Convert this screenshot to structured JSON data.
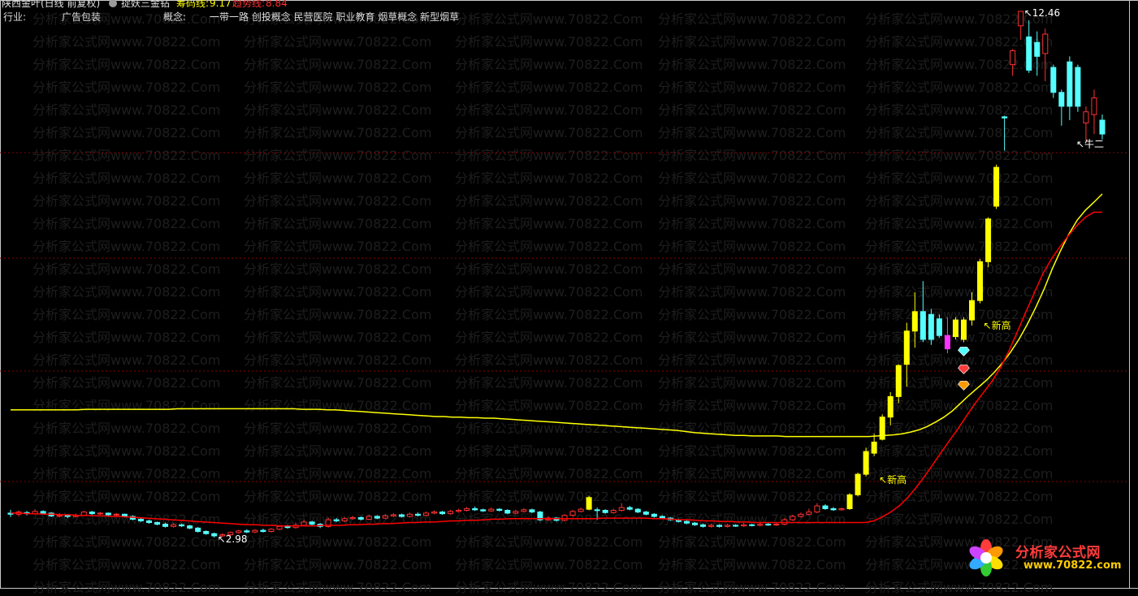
{
  "header": {
    "stock_name": "陕西金叶(日线 前复权)",
    "indicator_icon": "gear-icon",
    "indicator_name": "捉妖三金钻",
    "cost_label": "筹码线:",
    "cost_value": "9.17",
    "trend_label": "趋势线:",
    "trend_value": "8.84",
    "industry_label": "行业:",
    "industry_value": "广告包装",
    "concept_label": "概念:",
    "concept_value": "一带一路 创投概念 民营医院 职业教育 烟草概念 新型烟草"
  },
  "annotations": {
    "high_price": "12.46",
    "low_price": "2.98",
    "new_high_1": "新高",
    "new_high_2": "新高",
    "niu_er": "牛二",
    "arrow": "↖"
  },
  "watermark": {
    "text": "分析家公式网www.70822.Com"
  },
  "logo": {
    "name": "分析家公式网",
    "url": "www.70822.com"
  },
  "colors": {
    "up": "#ff3232",
    "down": "#54ffff",
    "strong_up": "#ffff00",
    "magenta": "#ff33ff",
    "cost_line": "#ffff00",
    "trend_line": "#ff0000",
    "grid": "#8b0000"
  },
  "chart_data": {
    "type": "candlestick",
    "title": "陕西金叶(日线 前复权)",
    "price_range": [
      2.98,
      12.46
    ],
    "series": [
      {
        "name": "筹码线",
        "last": 9.17
      },
      {
        "name": "趋势线",
        "last": 8.84
      }
    ],
    "candles": [
      {
        "o": 3.42,
        "c": 3.4,
        "h": 3.48,
        "l": 3.35
      },
      {
        "o": 3.4,
        "c": 3.44,
        "h": 3.47,
        "l": 3.36
      },
      {
        "o": 3.43,
        "c": 3.41,
        "h": 3.46,
        "l": 3.38
      },
      {
        "o": 3.41,
        "c": 3.45,
        "h": 3.49,
        "l": 3.39
      },
      {
        "o": 3.45,
        "c": 3.42,
        "h": 3.47,
        "l": 3.4
      },
      {
        "o": 3.42,
        "c": 3.37,
        "h": 3.44,
        "l": 3.35
      },
      {
        "o": 3.37,
        "c": 3.38,
        "h": 3.42,
        "l": 3.34
      },
      {
        "o": 3.38,
        "c": 3.36,
        "h": 3.4,
        "l": 3.33
      },
      {
        "o": 3.36,
        "c": 3.38,
        "h": 3.41,
        "l": 3.34
      },
      {
        "o": 3.38,
        "c": 3.44,
        "h": 3.46,
        "l": 3.37
      },
      {
        "o": 3.44,
        "c": 3.41,
        "h": 3.46,
        "l": 3.39
      },
      {
        "o": 3.41,
        "c": 3.42,
        "h": 3.44,
        "l": 3.39
      },
      {
        "o": 3.42,
        "c": 3.39,
        "h": 3.43,
        "l": 3.37
      },
      {
        "o": 3.39,
        "c": 3.4,
        "h": 3.42,
        "l": 3.37
      },
      {
        "o": 3.4,
        "c": 3.36,
        "h": 3.41,
        "l": 3.34
      },
      {
        "o": 3.36,
        "c": 3.31,
        "h": 3.38,
        "l": 3.29
      },
      {
        "o": 3.31,
        "c": 3.28,
        "h": 3.33,
        "l": 3.26
      },
      {
        "o": 3.28,
        "c": 3.25,
        "h": 3.3,
        "l": 3.23
      },
      {
        "o": 3.25,
        "c": 3.22,
        "h": 3.27,
        "l": 3.2
      },
      {
        "o": 3.22,
        "c": 3.18,
        "h": 3.25,
        "l": 3.16
      },
      {
        "o": 3.18,
        "c": 3.21,
        "h": 3.24,
        "l": 3.16
      },
      {
        "o": 3.21,
        "c": 3.19,
        "h": 3.23,
        "l": 3.17
      },
      {
        "o": 3.19,
        "c": 3.15,
        "h": 3.21,
        "l": 3.13
      },
      {
        "o": 3.15,
        "c": 3.09,
        "h": 3.17,
        "l": 3.07
      },
      {
        "o": 3.09,
        "c": 3.05,
        "h": 3.11,
        "l": 3.03
      },
      {
        "o": 3.05,
        "c": 3.01,
        "h": 3.07,
        "l": 2.98
      },
      {
        "o": 3.01,
        "c": 3.03,
        "h": 3.06,
        "l": 2.99
      },
      {
        "o": 3.03,
        "c": 3.07,
        "h": 3.09,
        "l": 3.01
      },
      {
        "o": 3.07,
        "c": 3.1,
        "h": 3.12,
        "l": 3.05
      },
      {
        "o": 3.1,
        "c": 3.08,
        "h": 3.13,
        "l": 3.06
      },
      {
        "o": 3.08,
        "c": 3.11,
        "h": 3.13,
        "l": 3.06
      },
      {
        "o": 3.11,
        "c": 3.09,
        "h": 3.14,
        "l": 3.07
      },
      {
        "o": 3.09,
        "c": 3.13,
        "h": 3.15,
        "l": 3.07
      },
      {
        "o": 3.13,
        "c": 3.18,
        "h": 3.2,
        "l": 3.11
      },
      {
        "o": 3.18,
        "c": 3.16,
        "h": 3.21,
        "l": 3.14
      },
      {
        "o": 3.16,
        "c": 3.2,
        "h": 3.25,
        "l": 3.14
      },
      {
        "o": 3.2,
        "c": 3.26,
        "h": 3.3,
        "l": 3.18
      },
      {
        "o": 3.26,
        "c": 3.22,
        "h": 3.28,
        "l": 3.2
      },
      {
        "o": 3.22,
        "c": 3.18,
        "h": 3.24,
        "l": 3.15
      },
      {
        "o": 3.18,
        "c": 3.3,
        "h": 3.34,
        "l": 3.16
      },
      {
        "o": 3.3,
        "c": 3.28,
        "h": 3.33,
        "l": 3.26
      },
      {
        "o": 3.28,
        "c": 3.32,
        "h": 3.35,
        "l": 3.26
      },
      {
        "o": 3.32,
        "c": 3.34,
        "h": 3.37,
        "l": 3.3
      },
      {
        "o": 3.34,
        "c": 3.31,
        "h": 3.36,
        "l": 3.29
      },
      {
        "o": 3.31,
        "c": 3.36,
        "h": 3.39,
        "l": 3.29
      },
      {
        "o": 3.36,
        "c": 3.33,
        "h": 3.38,
        "l": 3.31
      },
      {
        "o": 3.33,
        "c": 3.37,
        "h": 3.4,
        "l": 3.31
      },
      {
        "o": 3.37,
        "c": 3.39,
        "h": 3.42,
        "l": 3.35
      },
      {
        "o": 3.39,
        "c": 3.36,
        "h": 3.41,
        "l": 3.34
      },
      {
        "o": 3.36,
        "c": 3.4,
        "h": 3.43,
        "l": 3.34
      },
      {
        "o": 3.4,
        "c": 3.38,
        "h": 3.43,
        "l": 3.36
      },
      {
        "o": 3.38,
        "c": 3.42,
        "h": 3.45,
        "l": 3.36
      },
      {
        "o": 3.42,
        "c": 3.44,
        "h": 3.47,
        "l": 3.4
      },
      {
        "o": 3.44,
        "c": 3.41,
        "h": 3.46,
        "l": 3.39
      },
      {
        "o": 3.41,
        "c": 3.45,
        "h": 3.48,
        "l": 3.39
      },
      {
        "o": 3.45,
        "c": 3.47,
        "h": 3.5,
        "l": 3.43
      },
      {
        "o": 3.47,
        "c": 3.5,
        "h": 3.53,
        "l": 3.45
      },
      {
        "o": 3.5,
        "c": 3.48,
        "h": 3.54,
        "l": 3.46
      },
      {
        "o": 3.48,
        "c": 3.46,
        "h": 3.5,
        "l": 3.44
      },
      {
        "o": 3.46,
        "c": 3.49,
        "h": 3.52,
        "l": 3.44
      },
      {
        "o": 3.49,
        "c": 3.47,
        "h": 3.51,
        "l": 3.45
      },
      {
        "o": 3.47,
        "c": 3.42,
        "h": 3.49,
        "l": 3.4
      },
      {
        "o": 3.42,
        "c": 3.45,
        "h": 3.48,
        "l": 3.4
      },
      {
        "o": 3.45,
        "c": 3.48,
        "h": 3.51,
        "l": 3.43
      },
      {
        "o": 3.48,
        "c": 3.44,
        "h": 3.5,
        "l": 3.42
      },
      {
        "o": 3.44,
        "c": 3.3,
        "h": 3.46,
        "l": 3.28
      },
      {
        "o": 3.3,
        "c": 3.33,
        "h": 3.36,
        "l": 3.28
      },
      {
        "o": 3.33,
        "c": 3.29,
        "h": 3.35,
        "l": 3.27
      },
      {
        "o": 3.29,
        "c": 3.38,
        "h": 3.4,
        "l": 3.27
      },
      {
        "o": 3.38,
        "c": 3.45,
        "h": 3.48,
        "l": 3.36
      },
      {
        "o": 3.45,
        "c": 3.49,
        "h": 3.52,
        "l": 3.43
      },
      {
        "o": 3.49,
        "c": 3.7,
        "h": 3.73,
        "l": 3.47
      },
      {
        "o": 3.48,
        "c": 3.47,
        "h": 3.52,
        "l": 3.3
      },
      {
        "o": 3.47,
        "c": 3.43,
        "h": 3.49,
        "l": 3.41
      },
      {
        "o": 3.43,
        "c": 3.47,
        "h": 3.5,
        "l": 3.41
      },
      {
        "o": 3.47,
        "c": 3.52,
        "h": 3.6,
        "l": 3.45
      },
      {
        "o": 3.52,
        "c": 3.49,
        "h": 3.55,
        "l": 3.47
      },
      {
        "o": 3.49,
        "c": 3.44,
        "h": 3.51,
        "l": 3.42
      },
      {
        "o": 3.44,
        "c": 3.4,
        "h": 3.46,
        "l": 3.38
      },
      {
        "o": 3.4,
        "c": 3.36,
        "h": 3.42,
        "l": 3.34
      },
      {
        "o": 3.36,
        "c": 3.33,
        "h": 3.38,
        "l": 3.31
      },
      {
        "o": 3.33,
        "c": 3.3,
        "h": 3.35,
        "l": 3.28
      },
      {
        "o": 3.3,
        "c": 3.27,
        "h": 3.32,
        "l": 3.25
      },
      {
        "o": 3.27,
        "c": 3.24,
        "h": 3.29,
        "l": 3.22
      },
      {
        "o": 3.24,
        "c": 3.21,
        "h": 3.26,
        "l": 3.19
      },
      {
        "o": 3.21,
        "c": 3.18,
        "h": 3.23,
        "l": 3.16
      },
      {
        "o": 3.18,
        "c": 3.2,
        "h": 3.23,
        "l": 3.16
      },
      {
        "o": 3.2,
        "c": 3.18,
        "h": 3.22,
        "l": 3.16
      },
      {
        "o": 3.18,
        "c": 3.2,
        "h": 3.23,
        "l": 3.16
      },
      {
        "o": 3.2,
        "c": 3.19,
        "h": 3.22,
        "l": 3.17
      },
      {
        "o": 3.19,
        "c": 3.21,
        "h": 3.24,
        "l": 3.17
      },
      {
        "o": 3.21,
        "c": 3.2,
        "h": 3.23,
        "l": 3.18
      },
      {
        "o": 3.2,
        "c": 3.22,
        "h": 3.25,
        "l": 3.18
      },
      {
        "o": 3.22,
        "c": 3.21,
        "h": 3.24,
        "l": 3.19
      },
      {
        "o": 3.21,
        "c": 3.22,
        "h": 3.25,
        "l": 3.19
      },
      {
        "o": 3.22,
        "c": 3.3,
        "h": 3.33,
        "l": 3.2
      },
      {
        "o": 3.3,
        "c": 3.36,
        "h": 3.39,
        "l": 3.28
      },
      {
        "o": 3.36,
        "c": 3.4,
        "h": 3.43,
        "l": 3.34
      },
      {
        "o": 3.4,
        "c": 3.44,
        "h": 3.5,
        "l": 3.38
      },
      {
        "o": 3.44,
        "c": 3.55,
        "h": 3.6,
        "l": 3.42
      },
      {
        "o": 3.55,
        "c": 3.5,
        "h": 3.58,
        "l": 3.48
      },
      {
        "o": 3.5,
        "c": 3.48,
        "h": 3.53,
        "l": 3.46
      },
      {
        "o": 3.48,
        "c": 3.5,
        "h": 3.52,
        "l": 3.46
      },
      {
        "o": 3.5,
        "c": 3.75,
        "h": 3.78,
        "l": 3.48
      },
      {
        "o": 3.75,
        "c": 4.12,
        "h": 4.15,
        "l": 3.72
      },
      {
        "o": 4.12,
        "c": 4.53,
        "h": 4.6,
        "l": 4.08
      },
      {
        "o": 4.5,
        "c": 4.7,
        "h": 4.85,
        "l": 4.45
      },
      {
        "o": 4.75,
        "c": 5.15,
        "h": 5.2,
        "l": 4.73
      },
      {
        "o": 5.15,
        "c": 5.52,
        "h": 5.6,
        "l": 5.0
      },
      {
        "o": 5.52,
        "c": 6.08,
        "h": 6.1,
        "l": 5.4
      },
      {
        "o": 6.1,
        "c": 6.7,
        "h": 6.85,
        "l": 5.7
      },
      {
        "o": 6.7,
        "c": 7.05,
        "h": 7.4,
        "l": 6.4
      },
      {
        "o": 7.05,
        "c": 6.55,
        "h": 7.6,
        "l": 6.5
      },
      {
        "o": 7.0,
        "c": 6.55,
        "h": 7.1,
        "l": 6.45
      },
      {
        "o": 6.92,
        "c": 6.62,
        "h": 7.0,
        "l": 6.58
      },
      {
        "o": 6.38,
        "c": 6.62,
        "h": 6.95,
        "l": 6.3
      },
      {
        "o": 6.6,
        "c": 6.9,
        "h": 6.95,
        "l": 6.55
      },
      {
        "o": 6.55,
        "c": 6.9,
        "h": 6.95,
        "l": 6.5
      },
      {
        "o": 6.9,
        "c": 7.25,
        "h": 7.4,
        "l": 6.8
      },
      {
        "o": 7.25,
        "c": 7.95,
        "h": 8.0,
        "l": 7.2
      },
      {
        "o": 7.95,
        "c": 8.72,
        "h": 8.75,
        "l": 7.85
      },
      {
        "o": 8.95,
        "c": 9.65,
        "h": 9.7,
        "l": 8.9
      },
      {
        "o": 10.56,
        "c": 10.54,
        "h": 10.58,
        "l": 9.95
      },
      {
        "o": 11.5,
        "c": 11.75,
        "h": 11.78,
        "l": 11.3
      },
      {
        "o": 12.2,
        "c": 12.46,
        "h": 12.46,
        "l": 11.95
      },
      {
        "o": 12.0,
        "c": 11.4,
        "h": 12.3,
        "l": 11.35
      },
      {
        "o": 11.9,
        "c": 11.65,
        "h": 12.1,
        "l": 11.3
      },
      {
        "o": 11.7,
        "c": 12.05,
        "h": 12.15,
        "l": 11.2
      },
      {
        "o": 11.45,
        "c": 11.0,
        "h": 11.5,
        "l": 10.9
      },
      {
        "o": 11.0,
        "c": 10.75,
        "h": 11.05,
        "l": 10.4
      },
      {
        "o": 11.55,
        "c": 10.75,
        "h": 11.65,
        "l": 10.5
      },
      {
        "o": 11.45,
        "c": 10.75,
        "h": 11.5,
        "l": 10.65
      },
      {
        "o": 10.45,
        "c": 10.65,
        "h": 10.75,
        "l": 10.1
      },
      {
        "o": 10.6,
        "c": 10.9,
        "h": 11.05,
        "l": 10.25
      },
      {
        "o": 10.5,
        "c": 10.25,
        "h": 10.6,
        "l": 10.15
      }
    ],
    "cost_line": [
      5.28,
      5.28,
      5.28,
      5.28,
      5.28,
      5.28,
      5.28,
      5.28,
      5.28,
      5.29,
      5.29,
      5.29,
      5.29,
      5.29,
      5.29,
      5.29,
      5.29,
      5.29,
      5.29,
      5.29,
      5.3,
      5.3,
      5.3,
      5.3,
      5.3,
      5.3,
      5.3,
      5.3,
      5.3,
      5.3,
      5.3,
      5.3,
      5.3,
      5.3,
      5.3,
      5.29,
      5.29,
      5.29,
      5.28,
      5.28,
      5.27,
      5.26,
      5.25,
      5.24,
      5.23,
      5.22,
      5.21,
      5.2,
      5.19,
      5.18,
      5.17,
      5.16,
      5.16,
      5.15,
      5.15,
      5.14,
      5.14,
      5.13,
      5.13,
      5.12,
      5.11,
      5.1,
      5.09,
      5.08,
      5.07,
      5.06,
      5.05,
      5.04,
      5.03,
      5.02,
      5.01,
      5.0,
      4.99,
      4.98,
      4.97,
      4.96,
      4.95,
      4.94,
      4.93,
      4.92,
      4.91,
      4.89,
      4.87,
      4.86,
      4.85,
      4.84,
      4.83,
      4.82,
      4.82,
      4.81,
      4.81,
      4.81,
      4.81,
      4.8,
      4.8,
      4.8,
      4.8,
      4.8,
      4.8,
      4.8,
      4.8,
      4.8,
      4.8,
      4.8,
      4.81,
      4.82,
      4.83,
      4.85,
      4.88,
      4.92,
      4.98,
      5.06,
      5.15,
      5.26,
      5.4,
      5.54,
      5.67,
      5.8,
      5.95,
      6.12,
      6.32,
      6.55,
      6.82,
      7.12,
      7.45,
      7.82,
      8.15,
      8.45,
      8.7,
      8.88,
      9.02,
      9.17
    ],
    "trend_line": [
      3.42,
      3.42,
      3.41,
      3.41,
      3.4,
      3.4,
      3.39,
      3.39,
      3.38,
      3.38,
      3.37,
      3.37,
      3.36,
      3.36,
      3.35,
      3.34,
      3.33,
      3.32,
      3.31,
      3.3,
      3.29,
      3.28,
      3.27,
      3.26,
      3.25,
      3.24,
      3.23,
      3.22,
      3.21,
      3.21,
      3.2,
      3.2,
      3.19,
      3.19,
      3.19,
      3.19,
      3.19,
      3.2,
      3.2,
      3.2,
      3.21,
      3.21,
      3.22,
      3.22,
      3.23,
      3.23,
      3.24,
      3.25,
      3.25,
      3.26,
      3.26,
      3.27,
      3.28,
      3.28,
      3.29,
      3.29,
      3.3,
      3.31,
      3.31,
      3.32,
      3.32,
      3.32,
      3.32,
      3.32,
      3.32,
      3.32,
      3.32,
      3.32,
      3.32,
      3.32,
      3.33,
      3.33,
      3.33,
      3.33,
      3.33,
      3.33,
      3.32,
      3.32,
      3.31,
      3.3,
      3.3,
      3.29,
      3.28,
      3.28,
      3.27,
      3.27,
      3.26,
      3.26,
      3.25,
      3.25,
      3.25,
      3.25,
      3.25,
      3.25,
      3.25,
      3.25,
      3.25,
      3.25,
      3.25,
      3.25,
      3.25,
      3.25,
      3.28,
      3.35,
      3.44,
      3.55,
      3.7,
      3.88,
      4.08,
      4.3,
      4.52,
      4.74,
      4.95,
      5.18,
      5.4,
      5.6,
      5.8,
      6.05,
      6.35,
      6.7,
      7.05,
      7.4,
      7.74,
      8.0,
      8.22,
      8.42,
      8.6,
      8.75,
      8.84,
      8.84
    ]
  }
}
